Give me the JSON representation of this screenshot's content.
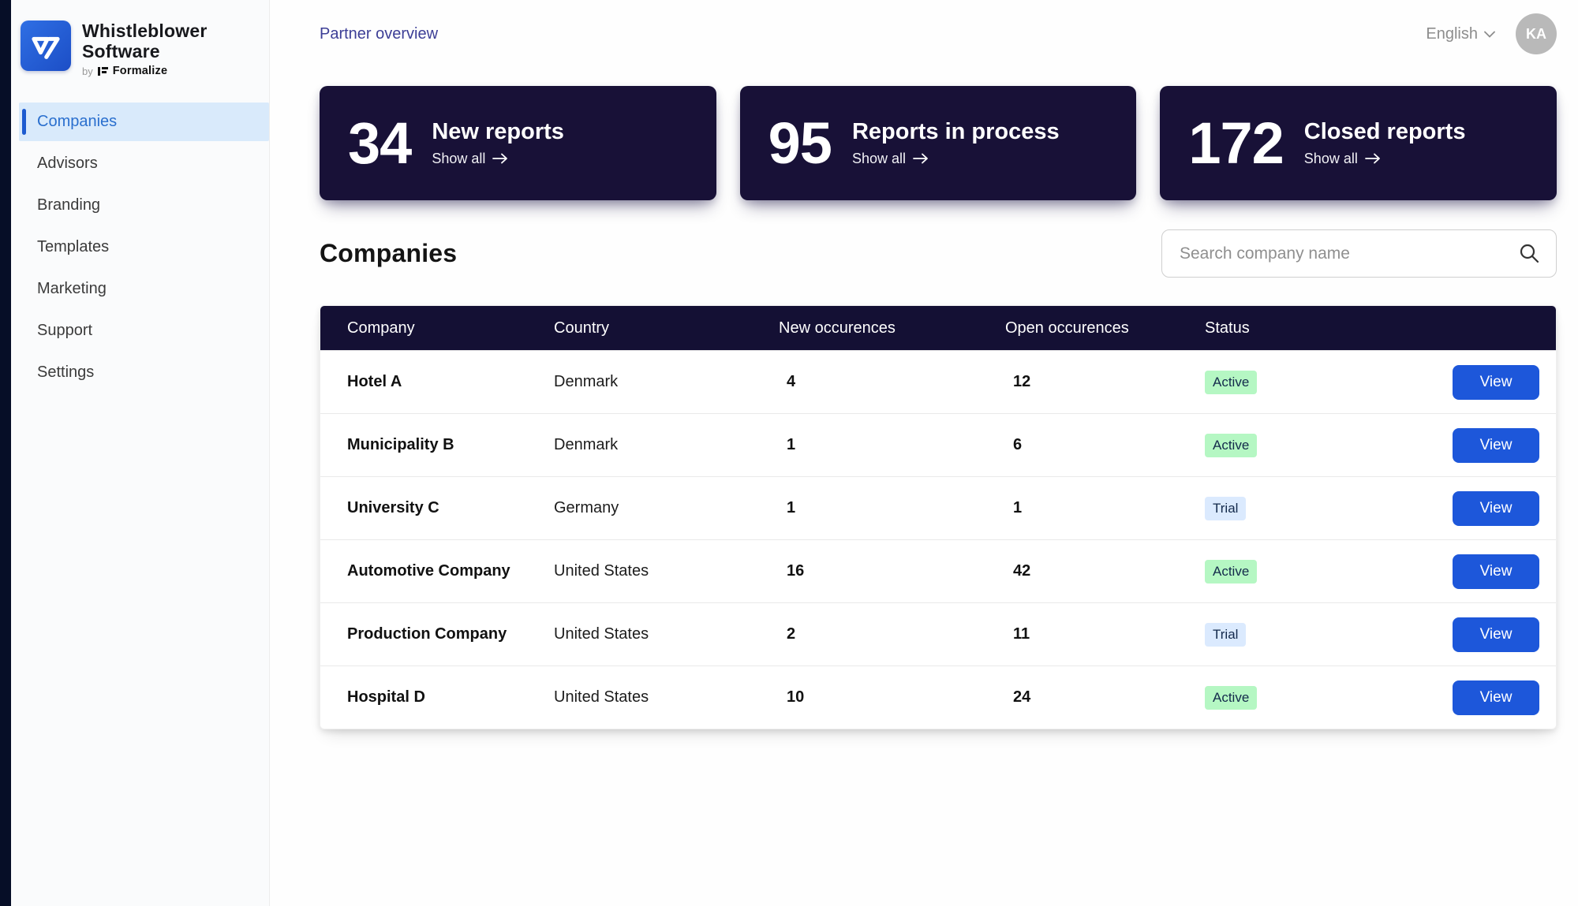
{
  "brand": {
    "name_line1": "Whistleblower",
    "name_line2": "Software",
    "byline_prefix": "by",
    "byline_brand": "Formalize"
  },
  "sidebar": {
    "items": [
      {
        "label": "Companies",
        "active": true
      },
      {
        "label": "Advisors",
        "active": false
      },
      {
        "label": "Branding",
        "active": false
      },
      {
        "label": "Templates",
        "active": false
      },
      {
        "label": "Marketing",
        "active": false
      },
      {
        "label": "Support",
        "active": false
      },
      {
        "label": "Settings",
        "active": false
      }
    ]
  },
  "header": {
    "breadcrumb": "Partner overview",
    "language": "English",
    "avatar_initials": "KA"
  },
  "stats": [
    {
      "value": "34",
      "label": "New reports",
      "link": "Show all"
    },
    {
      "value": "95",
      "label": "Reports in process",
      "link": "Show all"
    },
    {
      "value": "172",
      "label": "Closed reports",
      "link": "Show all"
    }
  ],
  "companies_section": {
    "title": "Companies",
    "search_placeholder": "Search company name"
  },
  "table": {
    "columns": [
      "Company",
      "Country",
      "New occurences",
      "Open occurences",
      "Status"
    ],
    "action_label": "View",
    "rows": [
      {
        "company": "Hotel A",
        "country": "Denmark",
        "new_occurences": "4",
        "open_occurences": "12",
        "status": "Active"
      },
      {
        "company": "Municipality B",
        "country": "Denmark",
        "new_occurences": "1",
        "open_occurences": "6",
        "status": "Active"
      },
      {
        "company": "University C",
        "country": "Germany",
        "new_occurences": "1",
        "open_occurences": "1",
        "status": "Trial"
      },
      {
        "company": "Automotive Company",
        "country": "United States",
        "new_occurences": "16",
        "open_occurences": "42",
        "status": "Active"
      },
      {
        "company": "Production Company",
        "country": "United States",
        "new_occurences": "2",
        "open_occurences": "11",
        "status": "Trial"
      },
      {
        "company": "Hospital D",
        "country": "United States",
        "new_occurences": "10",
        "open_occurences": "24",
        "status": "Active"
      }
    ]
  },
  "colors": {
    "accent_blue": "#1d57da",
    "dark_navy_card": "#181137",
    "table_header_navy": "#141034",
    "left_strip": "#060e27",
    "active_nav_bg": "#d9eafb",
    "active_nav_text": "#2a6fce",
    "badge_active_bg": "#b5f7c3",
    "badge_trial_bg": "#dbeafe",
    "badge_text": "#13294b",
    "breadcrumb_text": "#3c3e96"
  }
}
